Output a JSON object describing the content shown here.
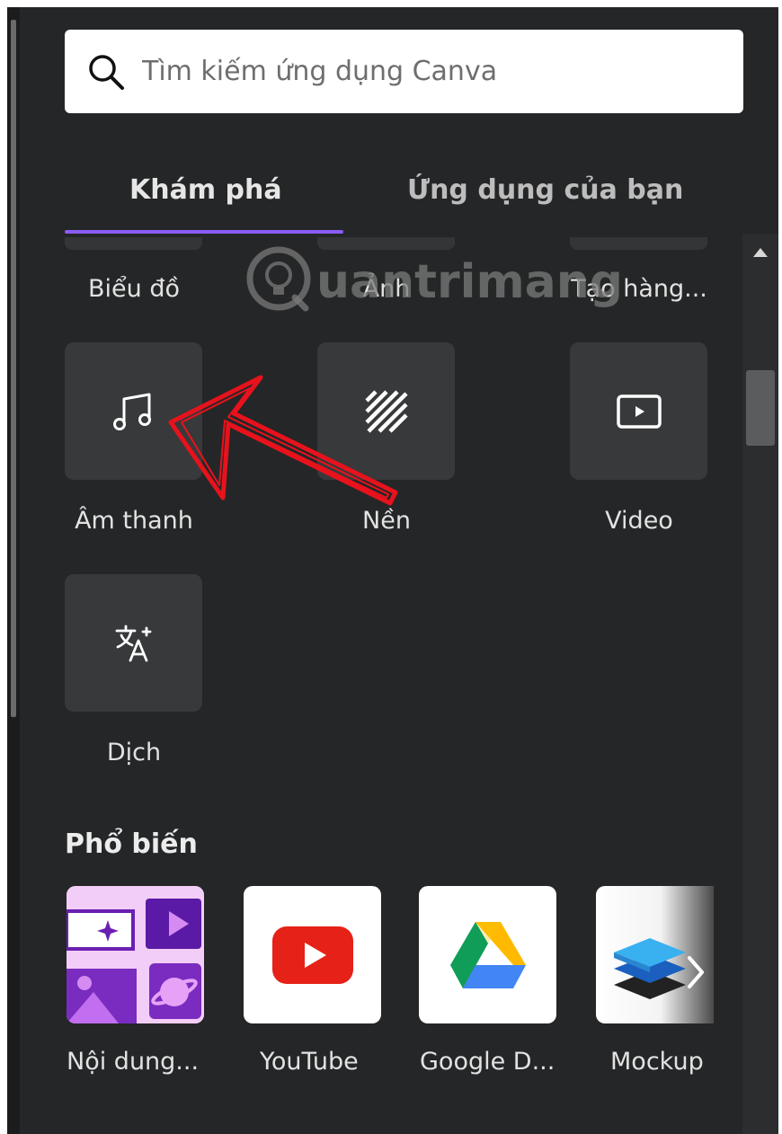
{
  "search": {
    "placeholder": "Tìm kiếm ứng dụng Canva",
    "icon": "search-icon"
  },
  "tabs": [
    {
      "label": "Khám phá",
      "active": true
    },
    {
      "label": "Ứng dụng của bạn",
      "active": false
    }
  ],
  "top_row_labels": [
    "Biểu đồ",
    "Ảnh",
    "Tạo hàng..."
  ],
  "tools": [
    {
      "label": "Âm thanh",
      "icon": "music-note-icon"
    },
    {
      "label": "Nền",
      "icon": "diagonal-stripes-icon"
    },
    {
      "label": "Video",
      "icon": "play-video-icon"
    },
    {
      "label": "Dịch",
      "icon": "translate-icon"
    }
  ],
  "popular": {
    "title": "Phổ biến",
    "apps": [
      {
        "label": "Nội dung...",
        "icon": "magic-media-icon"
      },
      {
        "label": "YouTube",
        "icon": "youtube-icon"
      },
      {
        "label": "Google D...",
        "icon": "google-drive-icon"
      },
      {
        "label": "Mockup",
        "icon": "mockup-layers-icon"
      }
    ]
  },
  "watermark": {
    "text": "uantrimang"
  },
  "colors": {
    "panel_bg": "#252627",
    "tile_bg": "#38393a",
    "accent": "#8b5cf6",
    "annotation_arrow": "#e8121c",
    "youtube_red": "#e62117"
  }
}
